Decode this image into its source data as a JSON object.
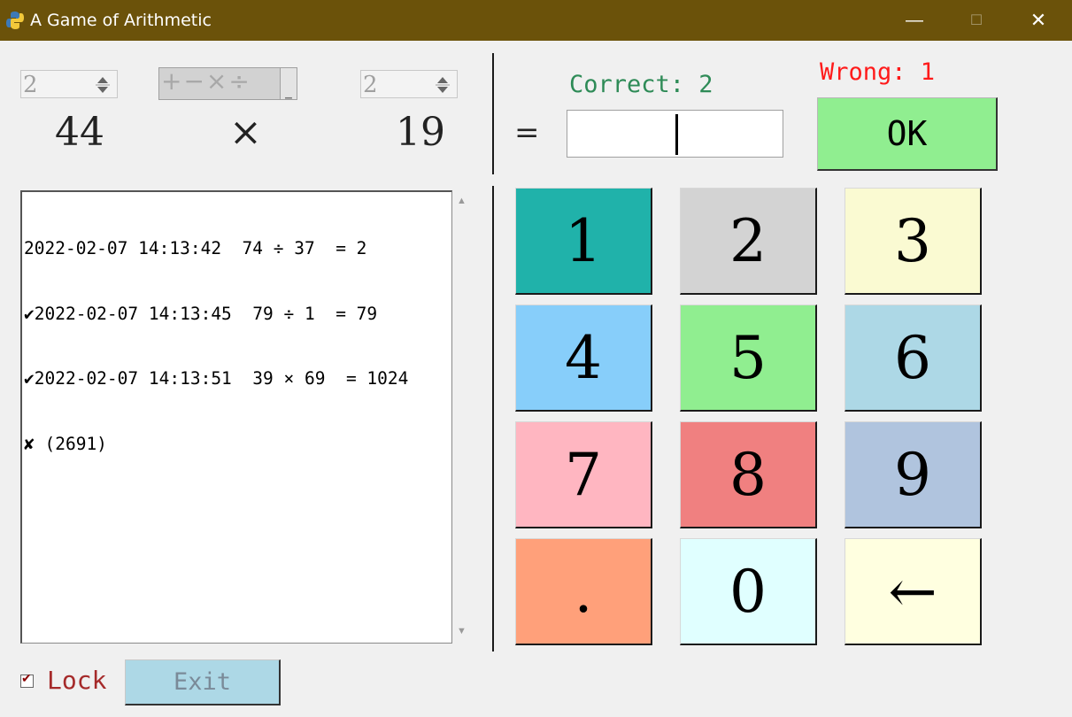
{
  "window": {
    "title": "A Game of Arithmetic",
    "icon": "python-logo-icon",
    "controls": {
      "minimize": "—",
      "maximize": "☐",
      "close": "✕"
    }
  },
  "problem": {
    "left_digits": "2",
    "operators": "+−×÷",
    "right_digits": "2",
    "operand1": "44",
    "operator": "×",
    "operand2": "19",
    "equals": "="
  },
  "answer": {
    "value": ""
  },
  "score": {
    "correct_label": "Correct: 2",
    "wrong_label": "Wrong: 1"
  },
  "ok_label": "OK",
  "history": {
    "lines": [
      "2022-02-07 14:13:42  74 ÷ 37  = 2",
      "✔2022-02-07 14:13:45  79 ÷ 1  = 79",
      "✔2022-02-07 14:13:51  39 × 69  = 1024",
      "✘ (2691)"
    ]
  },
  "keypad": {
    "keys": [
      {
        "label": "1",
        "color": "#20b2aa"
      },
      {
        "label": "2",
        "color": "#d3d3d3"
      },
      {
        "label": "3",
        "color": "#fafad2"
      },
      {
        "label": "4",
        "color": "#87cefa"
      },
      {
        "label": "5",
        "color": "#90ee90"
      },
      {
        "label": "6",
        "color": "#add8e6"
      },
      {
        "label": "7",
        "color": "#ffb6c1"
      },
      {
        "label": "8",
        "color": "#f08080"
      },
      {
        "label": "9",
        "color": "#b0c4de"
      },
      {
        "label": ".",
        "color": "#ffa07a"
      },
      {
        "label": "0",
        "color": "#e0ffff"
      },
      {
        "label": "←",
        "color": "#ffffe0"
      }
    ]
  },
  "lock": {
    "label": "Lock",
    "checked": true,
    "check_glyph": "✔"
  },
  "exit_label": "Exit",
  "colors": {
    "titlebar": "#6b520a",
    "correct": "#2e8b57",
    "wrong": "#ff1a1a",
    "ok_button": "#90ee90",
    "exit_button": "#add8e6",
    "lock_label": "#a52a2a"
  }
}
